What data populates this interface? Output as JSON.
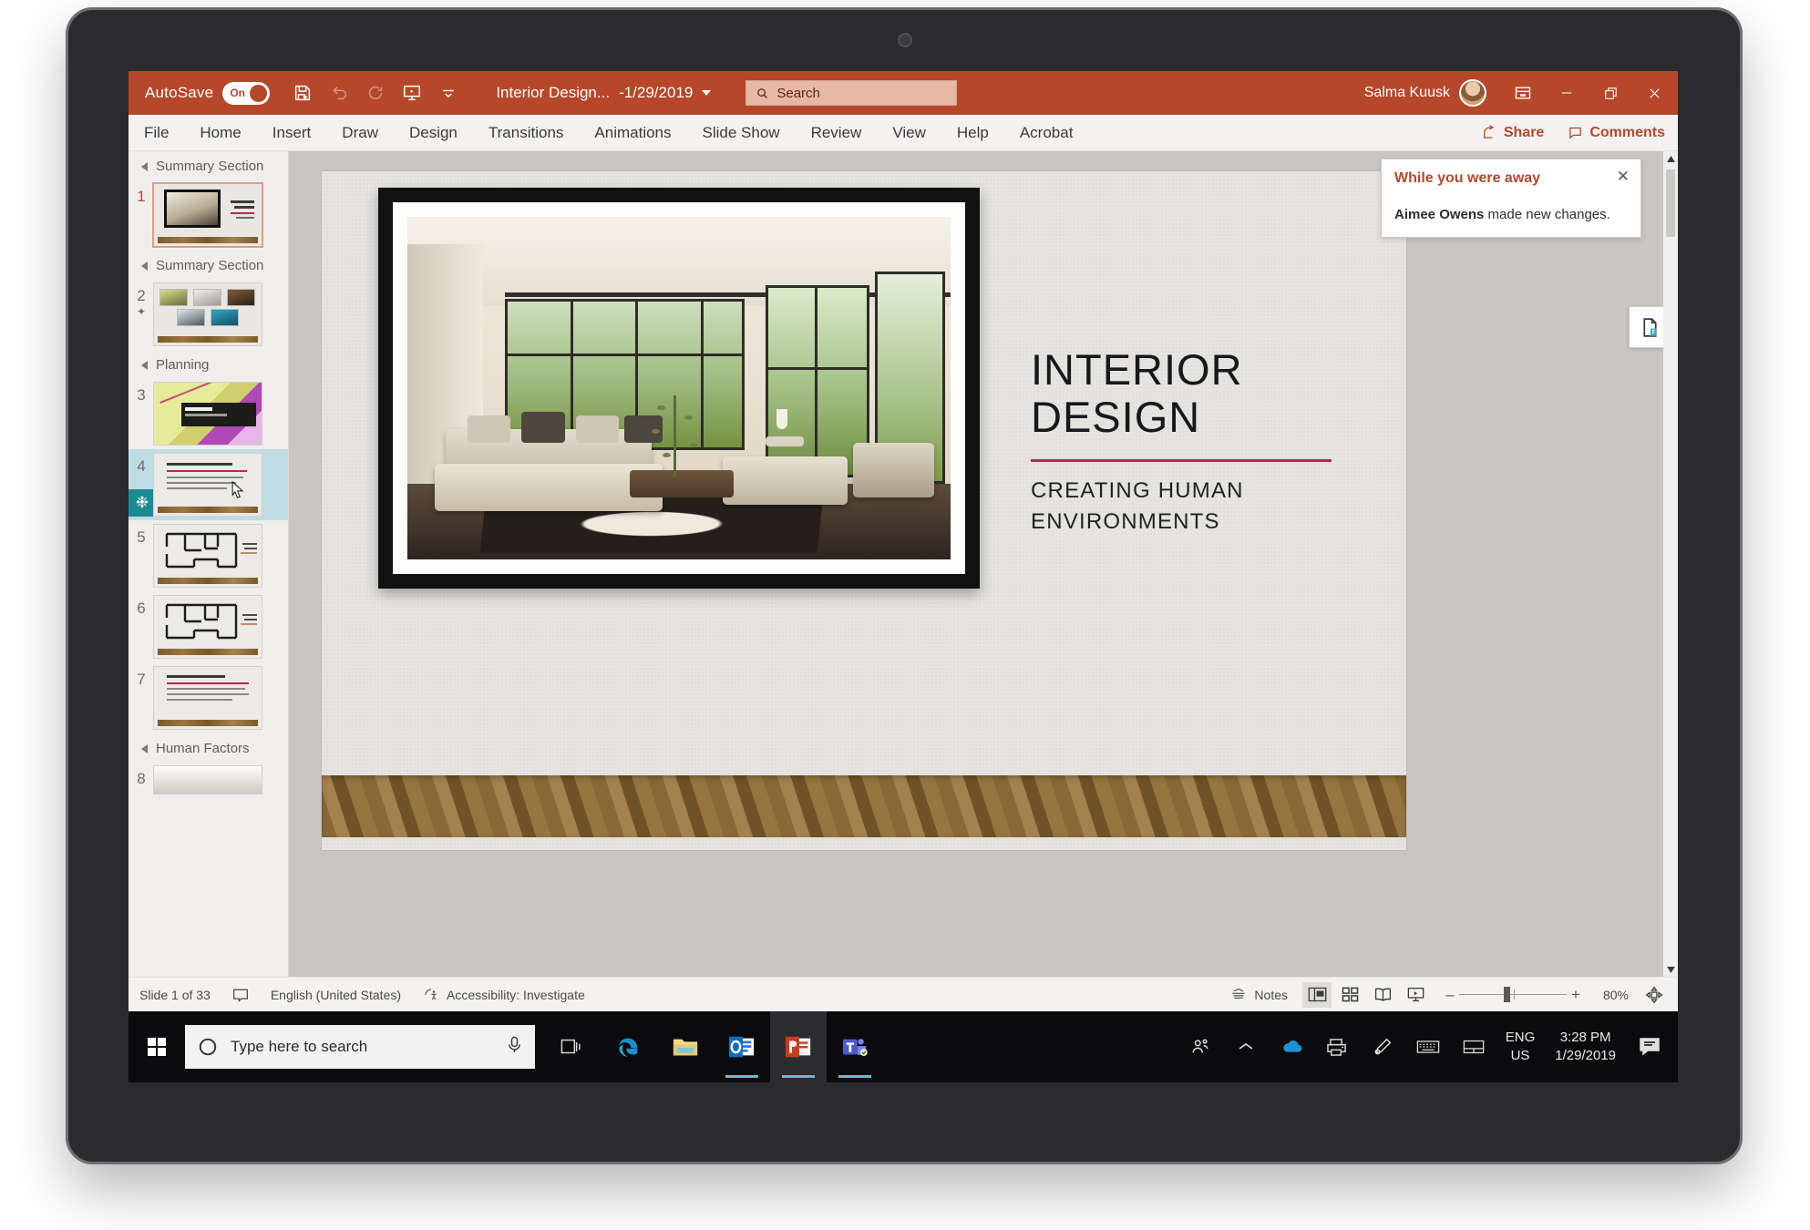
{
  "titlebar": {
    "autosave_label": "AutoSave",
    "autosave_state": "On",
    "doc_title": "Interior Design...",
    "doc_date": "-1/29/2019",
    "user_name": "Salma Kuusk",
    "accent_color": "#b7472a"
  },
  "search": {
    "placeholder": "Search",
    "value": ""
  },
  "quick_access": [
    {
      "name": "save-icon",
      "label": "Save",
      "enabled": true
    },
    {
      "name": "undo-icon",
      "label": "Undo",
      "enabled": false
    },
    {
      "name": "redo-icon",
      "label": "Redo",
      "enabled": false
    },
    {
      "name": "start-presentation-icon",
      "label": "Start From Beginning",
      "enabled": true
    },
    {
      "name": "customize-qat-icon",
      "label": "Customize Quick Access Toolbar",
      "enabled": true
    }
  ],
  "window_controls": [
    {
      "name": "ribbon-display-options-icon",
      "label": "Ribbon Display Options"
    },
    {
      "name": "minimize-icon",
      "label": "Minimize"
    },
    {
      "name": "restore-icon",
      "label": "Restore Down"
    },
    {
      "name": "close-icon",
      "label": "Close"
    }
  ],
  "ribbon": {
    "tabs": [
      "File",
      "Home",
      "Insert",
      "Draw",
      "Design",
      "Transitions",
      "Animations",
      "Slide Show",
      "Review",
      "View",
      "Help",
      "Acrobat"
    ],
    "active_tab": "Home",
    "share_label": "Share",
    "comments_label": "Comments"
  },
  "notification": {
    "title": "While you were away",
    "author": "Aimee Owens",
    "message": " made new changes.",
    "close_label": "✕"
  },
  "thumbnails": {
    "sections": [
      {
        "name": "Summary Section",
        "slides": [
          {
            "number": "1",
            "kind": "title-photo",
            "current": true,
            "selected": false,
            "star": false,
            "presence": false,
            "cursor": false
          }
        ]
      },
      {
        "name": "Summary Section",
        "slides": [
          {
            "number": "2",
            "kind": "photo-grid",
            "current": false,
            "selected": false,
            "star": true,
            "presence": false,
            "cursor": false
          }
        ]
      },
      {
        "name": "Planning",
        "slides": [
          {
            "number": "3",
            "kind": "planning-banner",
            "current": false,
            "selected": false,
            "star": false,
            "presence": false,
            "cursor": false
          },
          {
            "number": "4",
            "kind": "bullets",
            "current": false,
            "selected": true,
            "star": false,
            "presence": true,
            "cursor": true
          },
          {
            "number": "5",
            "kind": "floorplan",
            "current": false,
            "selected": false,
            "star": false,
            "presence": false,
            "cursor": false
          },
          {
            "number": "6",
            "kind": "floorplan",
            "current": false,
            "selected": false,
            "star": false,
            "presence": false,
            "cursor": false
          },
          {
            "number": "7",
            "kind": "bullets",
            "current": false,
            "selected": false,
            "star": false,
            "presence": false,
            "cursor": false
          }
        ]
      },
      {
        "name": "Human Factors",
        "slides": [
          {
            "number": "8",
            "kind": "photo",
            "current": false,
            "selected": false,
            "star": false,
            "presence": false,
            "cursor": false
          }
        ]
      }
    ]
  },
  "slide": {
    "title_line1": "INTERIOR",
    "title_line2": "DESIGN",
    "subtitle_line1": "CREATING HUMAN",
    "subtitle_line2": "ENVIRONMENTS",
    "rule_color": "#c0244b",
    "background_color": "#e6e4e0"
  },
  "designer": {
    "name": "design-ideas-icon",
    "label": "Design Ideas"
  },
  "statusbar": {
    "slide_counter": "Slide 1 of 33",
    "notes_icon_label": "notes-page-icon",
    "language": "English (United States)",
    "accessibility": "Accessibility: Investigate",
    "notes_label": "Notes",
    "views": [
      {
        "name": "normal-view-icon",
        "label": "Normal",
        "active": true
      },
      {
        "name": "slide-sorter-icon",
        "label": "Slide Sorter",
        "active": false
      },
      {
        "name": "reading-view-icon",
        "label": "Reading View",
        "active": false
      },
      {
        "name": "slide-show-icon",
        "label": "Slide Show",
        "active": false
      }
    ],
    "zoom_out": "–",
    "zoom_in": "+",
    "zoom_level": "80%",
    "fit_label": "Fit slide to current window"
  },
  "taskbar": {
    "start_label": "Start",
    "search_placeholder": "Type here to search",
    "search_value": "",
    "mic_label": "mic-icon",
    "apps": [
      {
        "name": "task-view-icon",
        "label": "Task View",
        "active": false,
        "running": false
      },
      {
        "name": "edge-icon",
        "label": "Microsoft Edge",
        "active": false,
        "running": false
      },
      {
        "name": "file-explorer-icon",
        "label": "File Explorer",
        "active": false,
        "running": false
      },
      {
        "name": "outlook-icon",
        "label": "Outlook",
        "active": false,
        "running": true
      },
      {
        "name": "powerpoint-icon",
        "label": "PowerPoint",
        "active": true,
        "running": true
      },
      {
        "name": "teams-icon",
        "label": "Microsoft Teams",
        "active": false,
        "running": true
      }
    ],
    "tray": [
      {
        "name": "people-icon",
        "label": "People"
      },
      {
        "name": "show-hidden-icons-icon",
        "label": "Show hidden icons"
      },
      {
        "name": "onedrive-icon",
        "label": "OneDrive"
      },
      {
        "name": "printer-icon",
        "label": "Printer"
      },
      {
        "name": "pen-icon",
        "label": "Windows Ink"
      },
      {
        "name": "keyboard-icon",
        "label": "Touch keyboard"
      },
      {
        "name": "touchpad-icon",
        "label": "Touchpad"
      }
    ],
    "language_line1": "ENG",
    "language_line2": "US",
    "clock_time": "3:28 PM",
    "clock_date": "1/29/2019",
    "action_center_label": "action-center-icon"
  }
}
